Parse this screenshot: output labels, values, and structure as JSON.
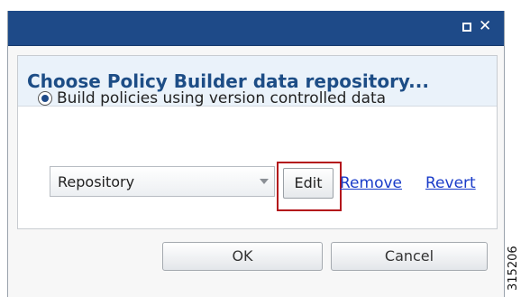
{
  "window": {
    "maximize_icon": "maximize-icon",
    "close_glyph": "✕"
  },
  "panel": {
    "heading": "Choose Policy Builder data repository..."
  },
  "radio": {
    "label": "Build policies using version controlled data",
    "selected": true
  },
  "repository_select": {
    "value": "Repository"
  },
  "actions": {
    "edit": "Edit",
    "remove": "Remove",
    "revert": "Revert"
  },
  "footer": {
    "ok": "OK",
    "cancel": "Cancel"
  },
  "figure_id": "315206",
  "colors": {
    "titlebar": "#1e4a88",
    "heading_text": "#1d4d86",
    "link": "#1a3cc9",
    "highlight_box": "#b3141b"
  }
}
